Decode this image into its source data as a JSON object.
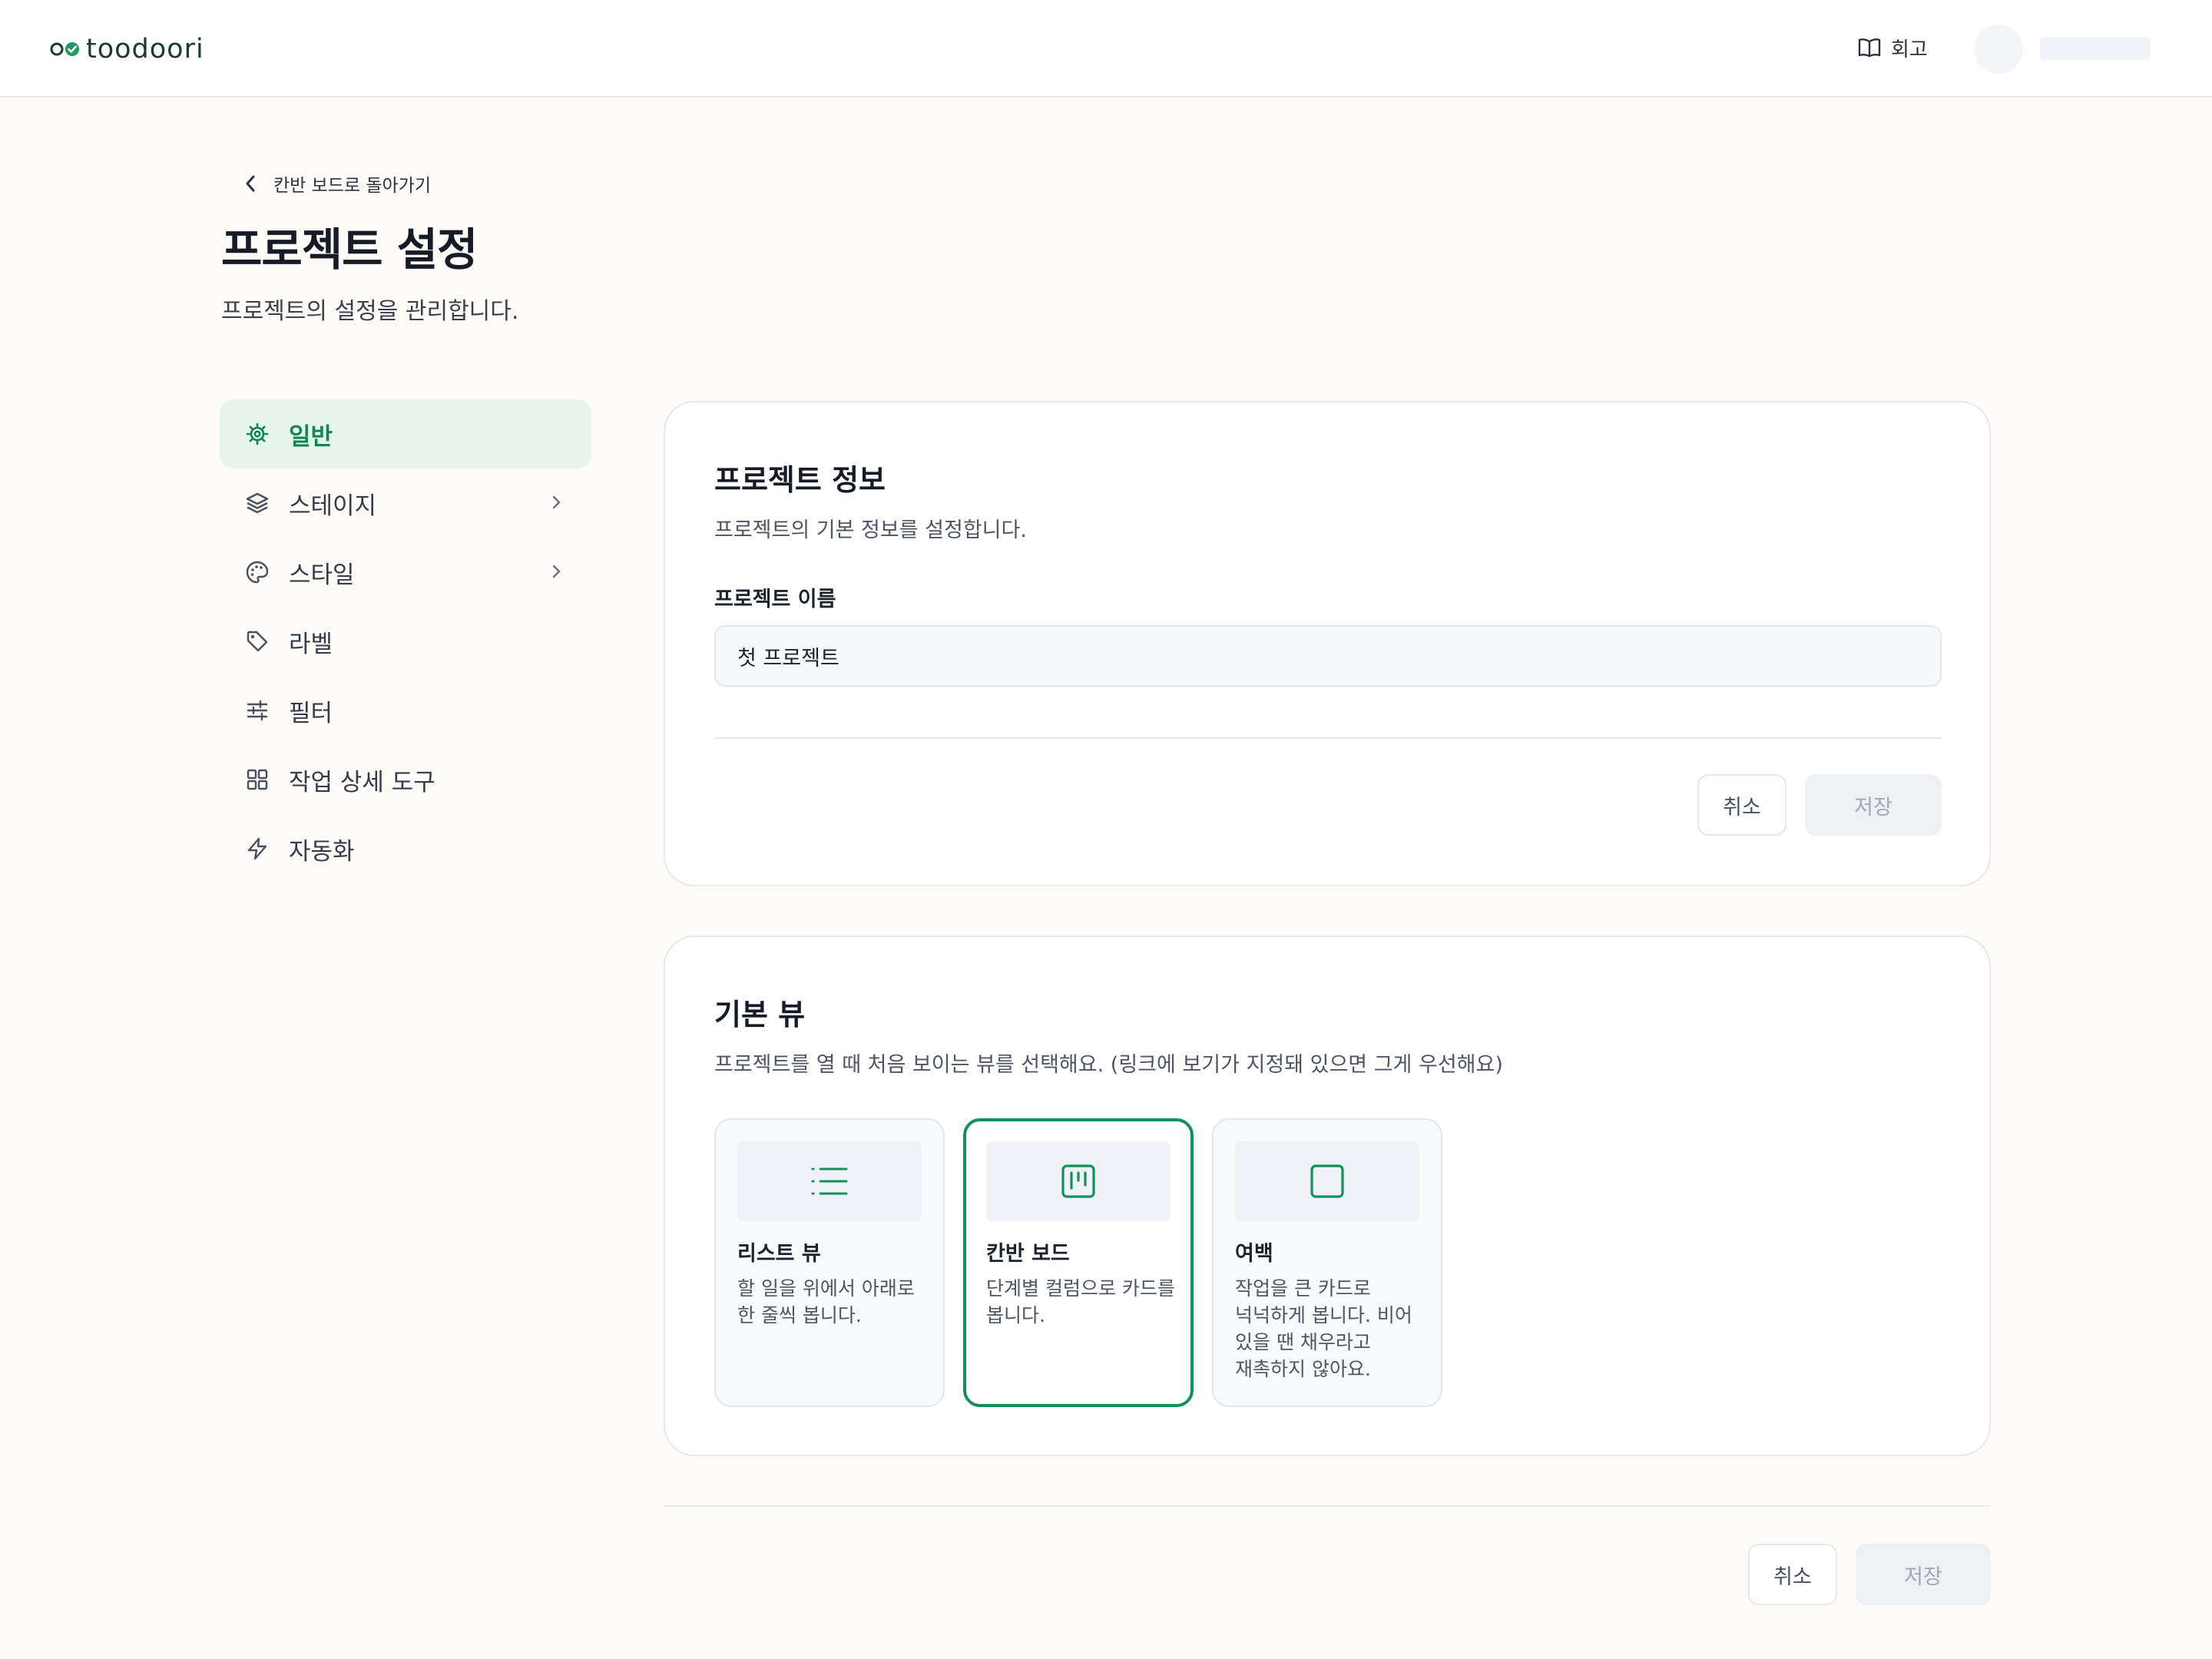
{
  "app": {
    "logo_text": "toodoori",
    "guide_label": "회고"
  },
  "header": {
    "back_label": "칸반 보드로 돌아가기",
    "title": "프로젝트 설정",
    "subtitle": "프로젝트의 설정을 관리합니다."
  },
  "sidebar": {
    "items": [
      {
        "label": "일반",
        "icon": "gear-icon",
        "active": true
      },
      {
        "label": "스테이지",
        "icon": "layers-icon",
        "has_submenu": true
      },
      {
        "label": "스타일",
        "icon": "palette-icon",
        "has_submenu": true
      },
      {
        "label": "라벨",
        "icon": "tag-icon"
      },
      {
        "label": "필터",
        "icon": "sliders-icon"
      },
      {
        "label": "작업 상세 도구",
        "icon": "grid-icon"
      },
      {
        "label": "자동화",
        "icon": "bolt-icon"
      }
    ]
  },
  "project_info": {
    "title": "프로젝트 정보",
    "description": "프로젝트의 기본 정보를 설정합니다.",
    "name_label": "프로젝트 이름",
    "name_value": "첫 프로젝트",
    "cancel_label": "취소",
    "save_label": "저장"
  },
  "default_view": {
    "title": "기본 뷰",
    "description": "프로젝트를 열 때 처음 보이는 뷰를 선택해요. (링크에 보기가 지정돼 있으면 그게 우선해요)",
    "options": [
      {
        "title": "리스트 뷰",
        "description": "할 일을 위에서 아래로 한 줄씩 봅니다.",
        "icon": "list-icon"
      },
      {
        "title": "칸반 보드",
        "description": "단계별 컬럼으로 카드를 봅니다.",
        "icon": "kanban-icon",
        "selected": true
      },
      {
        "title": "여백",
        "description": "작업을 큰 카드로 넉넉하게 봅니다. 비어 있을 땐 채우라고 재촉하지 않아요.",
        "icon": "square-icon"
      }
    ]
  },
  "footer": {
    "cancel_label": "취소",
    "save_label": "저장"
  },
  "colors": {
    "accent": "#13915c",
    "active_bg": "#e6f5eb",
    "page_bg": "#fdfbf8"
  }
}
